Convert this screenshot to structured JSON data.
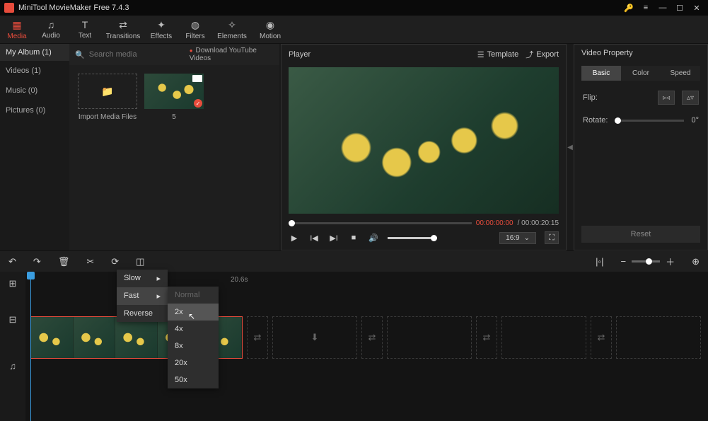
{
  "titlebar": {
    "title": "MiniTool MovieMaker Free 7.4.3"
  },
  "toolbar": [
    {
      "icon": "▦",
      "label": "Media",
      "name": "tool-media",
      "active": true
    },
    {
      "icon": "♫",
      "label": "Audio",
      "name": "tool-audio"
    },
    {
      "icon": "T",
      "label": "Text",
      "name": "tool-text"
    },
    {
      "icon": "⇄",
      "label": "Transitions",
      "name": "tool-transitions",
      "cls": "transitions"
    },
    {
      "icon": "✦",
      "label": "Effects",
      "name": "tool-effects"
    },
    {
      "icon": "◍",
      "label": "Filters",
      "name": "tool-filters"
    },
    {
      "icon": "✧",
      "label": "Elements",
      "name": "tool-elements",
      "cls": "elements"
    },
    {
      "icon": "◉",
      "label": "Motion",
      "name": "tool-motion",
      "cls": "motion"
    }
  ],
  "media": {
    "album": "My Album (1)",
    "cats": [
      "Videos (1)",
      "Music (0)",
      "Pictures (0)"
    ],
    "search_placeholder": "Search media",
    "download": "Download YouTube Videos",
    "import_label": "Import Media Files",
    "thumb_count": "5"
  },
  "player": {
    "title": "Player",
    "template": "Template",
    "export": "Export",
    "time_current": "00:00:00:00",
    "time_sep": " / ",
    "time_total": "00:00:20:15",
    "aspect": "16:9"
  },
  "props": {
    "title": "Video Property",
    "tabs": [
      "Basic",
      "Color",
      "Speed"
    ],
    "flip": "Flip:",
    "rotate": "Rotate:",
    "rotate_val": "0°",
    "reset": "Reset"
  },
  "timeline": {
    "tick1": "20.6s"
  },
  "menu_speed": {
    "slow": "Slow",
    "fast": "Fast",
    "reverse": "Reverse"
  },
  "menu_fast": {
    "normal": "Normal",
    "opts": [
      "2x",
      "4x",
      "8x",
      "20x",
      "50x"
    ]
  }
}
